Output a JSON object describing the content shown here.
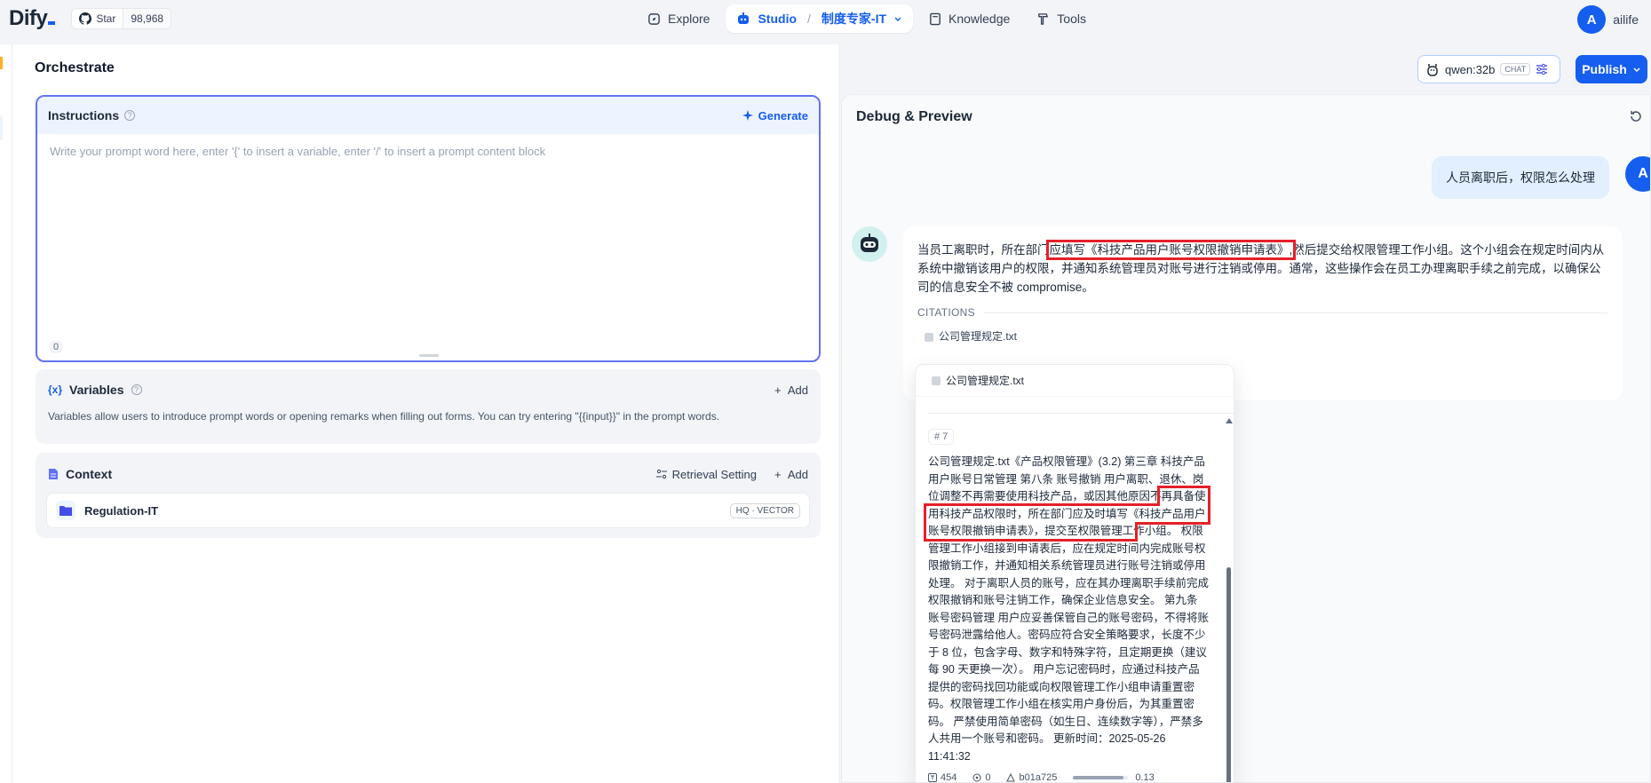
{
  "nav": {
    "logo": "Dify",
    "star_label": "Star",
    "star_count": "98,968",
    "explore": "Explore",
    "studio": "Studio",
    "app_name": "制度专家-IT",
    "knowledge": "Knowledge",
    "tools": "Tools",
    "user_initial": "A",
    "user_name": "ailife"
  },
  "orchestrate": {
    "title": "Orchestrate",
    "instructions": {
      "title": "Instructions",
      "generate": "Generate",
      "placeholder": "Write your prompt word here, enter '{' to insert a variable, enter '/' to insert a prompt content block",
      "count": "0"
    },
    "variables": {
      "title": "Variables",
      "add": "Add",
      "description": "Variables allow users to introduce prompt words or opening remarks when filling out forms. You can try entering \"{{input}}\" in the prompt words."
    },
    "context": {
      "title": "Context",
      "retrieval": "Retrieval Setting",
      "add": "Add",
      "item_name": "Regulation-IT",
      "item_badge": "HQ · VECTOR"
    }
  },
  "model": {
    "name": "qwen:32b",
    "tag": "CHAT"
  },
  "publish": "Publish",
  "debug": {
    "title": "Debug & Preview",
    "user_initial": "A",
    "user_message": "人员离职后，权限怎么处理",
    "answer_pre": "当员工离职时，所在部门",
    "answer_hl": "应填写《科技产品用户账号权限撤销申请表》,",
    "answer_post": "然后提交给权限管理工作小组。这个小组会在规定时间内从系统中撤销该用户的权限，并通知系统管理员对账号进行注销或停用。通常，这些操作会在员工办理离职手续之前完成，以确保公司的信息安全不被 compromise。",
    "citations_label": "CITATIONS",
    "citation_file": "公司管理规定.txt"
  },
  "popup": {
    "file": "公司管理规定.txt",
    "segment": "7",
    "text_pre": "公司管理规定.txt《产品权限管理》(3.2) 第三章 科技产品用户账号日常管理 第八条 账号撤销 用户离职、退休、岗位调整不再需要使用科技产品，或因其他原因不",
    "text_hl": "再具备使用科技产品权限时，所在部门应及时填写《科技产品用户账号权限撤销申请表》，提交至权限管理工",
    "text_post": "作小组。 权限管理工作小组接到申请表后，应在规定时间内完成账号权限撤销工作，并通知相关系统管理员进行账号注销或停用处理。 对于离职人员的账号，应在其办理离职手续前完成权限撤销和账号注销工作，确保企业信息安全。 第九条 账号密码管理 用户应妥善保管自己的账号密码，不得将账号密码泄露给他人。密码应符合安全策略要求，长度不少于 8 位，包含字母、数字和特殊字符，且定期更换（建议每 90 天更换一次）。 用户忘记密码时，应通过科技产品提供的密码找回功能或向权限管理工作小组申请重置密码。权限管理工作小组在核实用户身份后，为其重置密码。 严禁使用简单密码（如生日、连续数字等），严禁多人共用一个账号和密码。 更新时间：2025-05-26 11:41:32",
    "word_count": "454",
    "hit_count": "0",
    "hash": "b01a725",
    "score": "0.13",
    "score_value": 0.13
  }
}
